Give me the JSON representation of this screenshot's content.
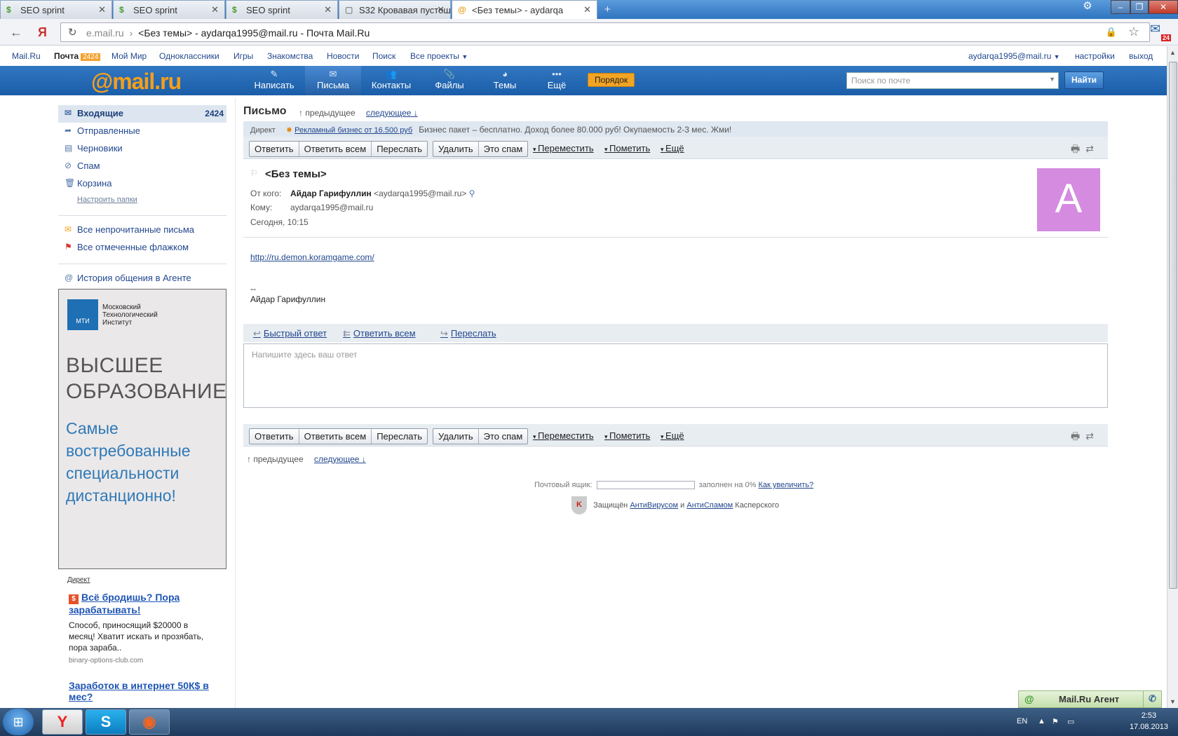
{
  "browser": {
    "tabs": [
      {
        "label": "SEO sprint"
      },
      {
        "label": "SEO sprint"
      },
      {
        "label": "SEO sprint"
      },
      {
        "label": "S32 Кровавая пустош"
      },
      {
        "label": "<Без темы> - aydarqa"
      }
    ],
    "url_host": "e.mail.ru",
    "url_sep": "›",
    "url_title": "<Без темы> - aydarqa1995@mail.ru - Почта Mail.Ru",
    "ext_badge": "24"
  },
  "portal": {
    "mailru": "Mail.Ru",
    "pochta": "Почта",
    "pochta_count": "2424",
    "moi_mir": "Мой Мир",
    "odnoklassniki": "Одноклассники",
    "igry": "Игры",
    "znakomstva": "Знакомства",
    "novosti": "Новости",
    "poisk": "Поиск",
    "vse_proekty": "Все проекты",
    "user": "aydarqa1995@mail.ru",
    "settings": "настройки",
    "logout": "выход"
  },
  "header": {
    "logo_at": "@mail",
    "logo_ru": ".ru",
    "buttons": [
      {
        "label": "Написать",
        "icon": "pencil-icon"
      },
      {
        "label": "Письма",
        "icon": "envelope-icon"
      },
      {
        "label": "Контакты",
        "icon": "contacts-icon"
      },
      {
        "label": "Файлы",
        "icon": "paperclip-icon"
      },
      {
        "label": "Темы",
        "icon": "palette-icon"
      },
      {
        "label": "Ещё",
        "icon": "dots-icon"
      }
    ],
    "poryadok": "Порядок",
    "search_placeholder": "Поиск по почте",
    "search_button": "Найти"
  },
  "sidebar": {
    "folders": [
      {
        "label": "Входящие",
        "count": "2424"
      },
      {
        "label": "Отправленные"
      },
      {
        "label": "Черновики"
      },
      {
        "label": "Спам"
      },
      {
        "label": "Корзина"
      }
    ],
    "configure": "Настроить папки",
    "unread": "Все непрочитанные письма",
    "flagged": "Все отмеченные флажком",
    "agent_history": "История общения в Агенте"
  },
  "ad_banner": {
    "mti_abbr": "МТИ",
    "mti_name": "Московский Технологический Институт",
    "headline": "ВЫСШЕЕ ОБРАЗОВАНИЕ",
    "subline": "Самые востребованные специальности дистанционно!"
  },
  "text_ads": {
    "label": "Директ",
    "ad1_title": "Всё бродишь? Пора зарабатывать!",
    "ad1_text": "Способ, приносящий $20000 в месяц! Хватит искать и прозябать, пора зараба..",
    "ad1_source": "binary-options-club.com",
    "ad2_title": "Заработок в интернет 50К$ в мес?"
  },
  "letter": {
    "heading": "Письмо",
    "prev": "предыдущее",
    "next": "следующее",
    "direkt_label": "Директ",
    "direkt_link": "Рекламный бизнес от 16.500 руб",
    "direkt_text": "Бизнес пакет – бесплатно. Доход более 80.000 руб! Окупаемость 2-3 мес. Жми!",
    "toolbar": {
      "reply": "Ответить",
      "reply_all": "Ответить всем",
      "forward": "Переслать",
      "delete": "Удалить",
      "spam": "Это спам",
      "move": "Переместить",
      "mark": "Пометить",
      "more": "Ещё"
    },
    "subject": "<Без темы>",
    "from_label": "От кого:",
    "from_name": "Айдар Гарифуллин",
    "from_email": "<aydarqa1995@mail.ru>",
    "to_label": "Кому:",
    "to_email": "aydarqa1995@mail.ru",
    "date": "Сегодня, 10:15",
    "avatar_letter": "A",
    "body_link": "http://ru.demon.koramgame.com/",
    "sig_dash": "--",
    "signature": "Айдар Гарифуллин",
    "quick_reply": "Быстрый ответ",
    "reply_all_link": "Ответить всем",
    "forward_link": "Переслать",
    "reply_placeholder": "Напишите здесь ваш ответ"
  },
  "footer": {
    "mailbox_label": "Почтовый ящик:",
    "filled": "заполнен на 0%",
    "increase": "Как увеличить?",
    "protected": "Защищён",
    "antivirus": "АнтиВирусом",
    "and": "и",
    "antispam": "АнтиСпамом",
    "kaspersky": "Касперского"
  },
  "agent": {
    "label": "Mail.Ru Агент"
  },
  "taskbar": {
    "lang": "EN",
    "time": "2:53",
    "date": "17.08.2013"
  }
}
